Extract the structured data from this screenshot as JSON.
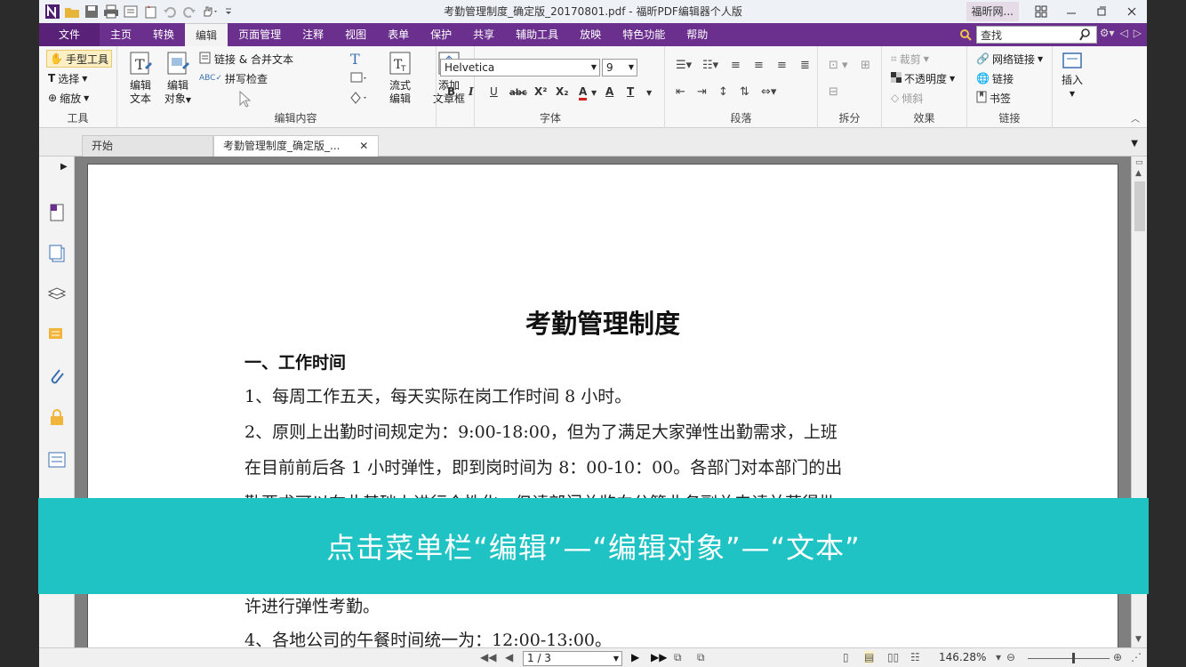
{
  "window": {
    "title": "考勤管理制度_确定版_20170801.pdf - 福昕PDF编辑器个人版",
    "account": "福昕网..."
  },
  "menu": {
    "file": "文件",
    "tabs": [
      "主页",
      "转换",
      "编辑",
      "页面管理",
      "注释",
      "视图",
      "表单",
      "保护",
      "共享",
      "辅助工具",
      "放映",
      "特色功能",
      "帮助"
    ],
    "active": "编辑",
    "search_placeholder": "查找"
  },
  "ribbon": {
    "tools": {
      "hand": "手型工具",
      "select": "选择",
      "zoom": "缩放",
      "label": "工具"
    },
    "edit_content": {
      "edit_text_1": "编辑",
      "edit_text_2": "文本",
      "edit_obj_1": "编辑",
      "edit_obj_2": "对象",
      "link_merge": "链接 & 合并文本",
      "spellcheck": "拼写检查",
      "flow_1": "流式",
      "flow_2": "编辑",
      "add_1": "添加",
      "add_2": "文章框",
      "label": "编辑内容"
    },
    "font": {
      "family": "Helvetica",
      "size": "9",
      "label": "字体"
    },
    "paragraph": {
      "label": "段落"
    },
    "split": {
      "label": "拆分"
    },
    "effects": {
      "crop": "裁剪",
      "opacity": "不透明度",
      "skew": "倾斜",
      "label": "效果"
    },
    "links": {
      "web_link": "网络链接",
      "link": "链接",
      "bookmark": "书签",
      "label": "链接"
    },
    "insert": {
      "label": "插入"
    }
  },
  "doc_tabs": [
    {
      "label": "开始"
    },
    {
      "label": "考勤管理制度_确定版_..."
    }
  ],
  "document": {
    "title": "考勤管理制度",
    "heading": "一、工作时间",
    "lines": [
      "1、每周工作五天，每天实际在岗工作时间 8 小时。",
      "2、原则上出勤时间规定为：9:00-18:00，但为了满足大家弹性出勤需求，上班",
      "在目前前后各 1 小时弹性，即到岗时间为 8：00-10：00。各部门对本部门的出",
      "勤要求可以在此基础上进行个性化，但请部门总监向分管业务副总申请并获得批",
      "许进行弹性考勤。",
      "4、各地公司的午餐时间统一为：12:00-13:00。"
    ]
  },
  "status": {
    "page": "1 / 3",
    "zoom": "146.28%"
  },
  "caption": "点击菜单栏“编辑”—“编辑对象”—“文本”",
  "colors": {
    "menubar": "#6b2f8e",
    "caption": "#1fc3c4",
    "doc_bg": "#7f7f7f"
  }
}
